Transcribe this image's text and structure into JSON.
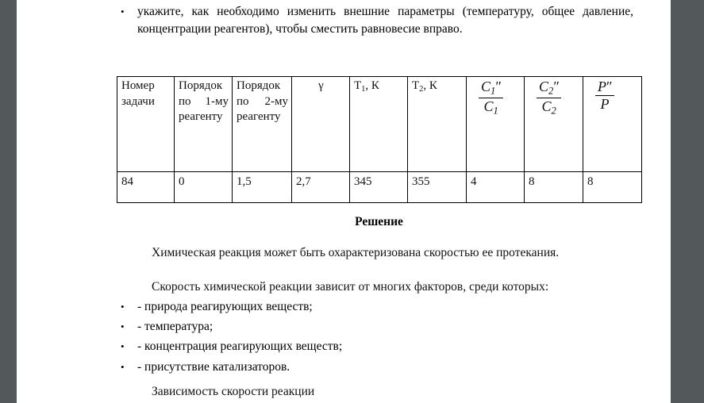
{
  "page": {
    "background_color": "#53585b",
    "paper_color": "#ffffff"
  },
  "intro_list": {
    "bullet_glyph": "•",
    "items": [
      "укажите, как необходимо изменить внешние параметры (температуру, общее давление, концентрации реагентов), чтобы сместить равновесие вправо."
    ]
  },
  "table": {
    "headers": [
      {
        "type": "text",
        "lines": [
          "Номер задачи"
        ]
      },
      {
        "type": "text",
        "lines": [
          "Порядок по 1-му реагенту"
        ]
      },
      {
        "type": "text",
        "lines": [
          "Порядок по 2-му реагенту"
        ]
      },
      {
        "type": "symbol",
        "text": "γ"
      },
      {
        "type": "subscripted",
        "base": "T",
        "sub": "1",
        "suffix": ", К"
      },
      {
        "type": "subscripted",
        "base": "T",
        "sub": "2",
        "suffix": ", К"
      },
      {
        "type": "fraction",
        "numerator": "C",
        "numerator_sub": "1",
        "numerator_prime": "″",
        "denominator": "C",
        "denominator_sub": "1"
      },
      {
        "type": "fraction",
        "numerator": "C",
        "numerator_sub": "2",
        "numerator_prime": "″",
        "denominator": "C",
        "denominator_sub": "2"
      },
      {
        "type": "fraction",
        "numerator": "P",
        "numerator_sub": "",
        "numerator_prime": "″",
        "denominator": "P",
        "denominator_sub": ""
      }
    ],
    "rows": [
      [
        "84",
        "0",
        "1,5",
        "2,7",
        "345",
        "355",
        "4",
        "8",
        "8"
      ]
    ]
  },
  "solution": {
    "heading": "Решение",
    "paragraph_rate": "Химическая реакция может быть охарактеризована скоростью ее протекания.",
    "paragraph_factors": "Скорость химической реакции зависит от многих факторов, среди которых:",
    "factor_bullet_glyph": "•",
    "factors": [
      "- природа реагирующих веществ;",
      "- температура;",
      "- концентрация реагирующих веществ;",
      "- присутствие катализаторов."
    ],
    "paragraph_dependence": "Зависимость скорости реакции"
  }
}
